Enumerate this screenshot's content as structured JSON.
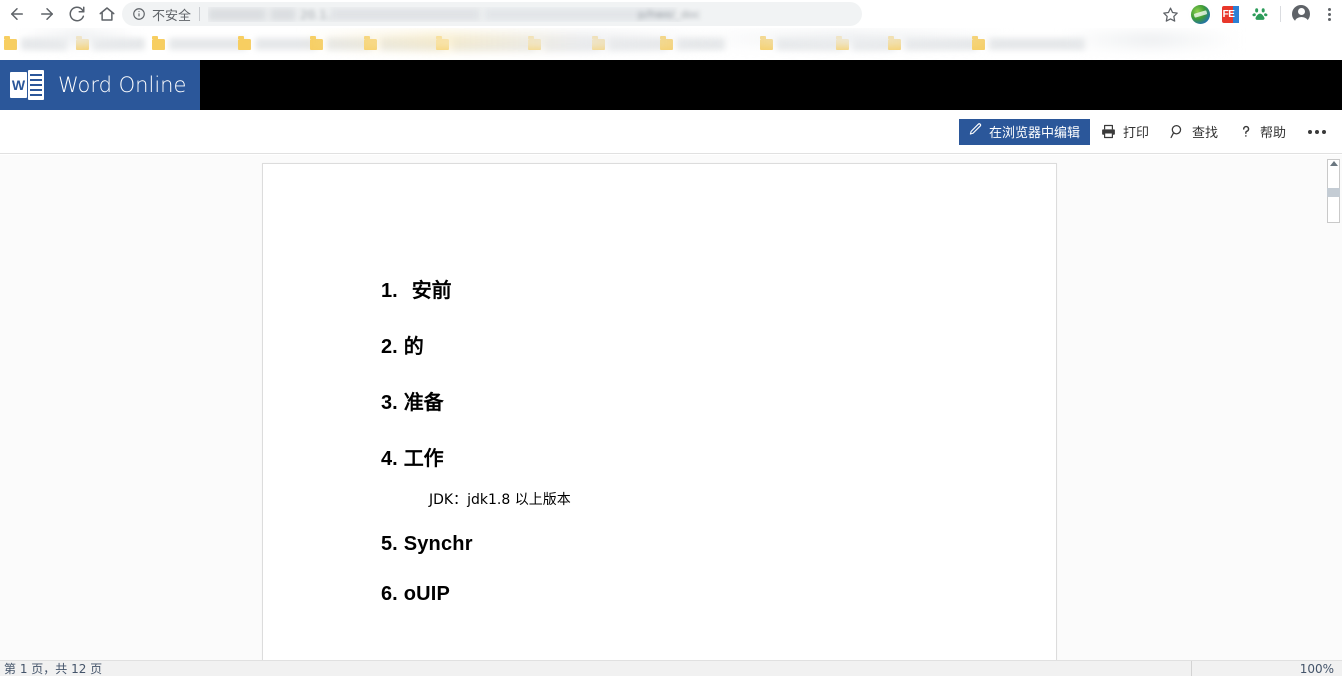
{
  "browser": {
    "nav": {
      "back": "back-arrow",
      "forward": "forward-arrow",
      "reload": "reload",
      "home": "home"
    },
    "omnibox": {
      "security_label": "不安全",
      "security_icon": "info-circle-icon",
      "url_redacted": "blurred",
      "url_ghost": "20.1.",
      "url_ghost_2": "p/hwe/_doc"
    },
    "toolbar_right": {
      "bookmark_star": "star-icon",
      "ext_idm": "idm-extension-icon",
      "ext_fe": "FE",
      "ext_baidu": "baidu-extension-icon",
      "profile": "profile-avatar",
      "menu": "chrome-menu-icon"
    },
    "bookmarks": {
      "redacted": true,
      "count": 14
    }
  },
  "app": {
    "brand_title": "Word Online",
    "brand_logo_letter": "W",
    "brand_color": "#2b579a",
    "header_bar_color": "#000000"
  },
  "toolbar": {
    "edit_in_browser": "在浏览器中编辑",
    "edit_icon": "pencil-icon",
    "print": "打印",
    "print_icon": "printer-icon",
    "find": "查找",
    "find_icon": "magnifier-icon",
    "help": "帮助",
    "help_icon": "question-mark-icon",
    "more": "more-options-icon"
  },
  "document": {
    "items": [
      {
        "num": "1.",
        "text": "安前",
        "latin": false,
        "extra_gap": true
      },
      {
        "num": "2.",
        "text": "的",
        "latin": false,
        "extra_gap": false
      },
      {
        "num": "3.",
        "text": "准备",
        "latin": false,
        "extra_gap": false
      },
      {
        "num": "4.",
        "text": "工作",
        "latin": false,
        "extra_gap": false
      },
      {
        "num": "5.",
        "text": "Synchr",
        "latin": true,
        "extra_gap": false
      },
      {
        "num": "6.",
        "text": "oUIP",
        "latin": true,
        "extra_gap": false
      }
    ],
    "sub_line": "JDK：jdk1.8 以上版本",
    "sub_line_after_item": 4
  },
  "status": {
    "page_info": "第 1 页，共 12 页",
    "zoom": "100%"
  }
}
